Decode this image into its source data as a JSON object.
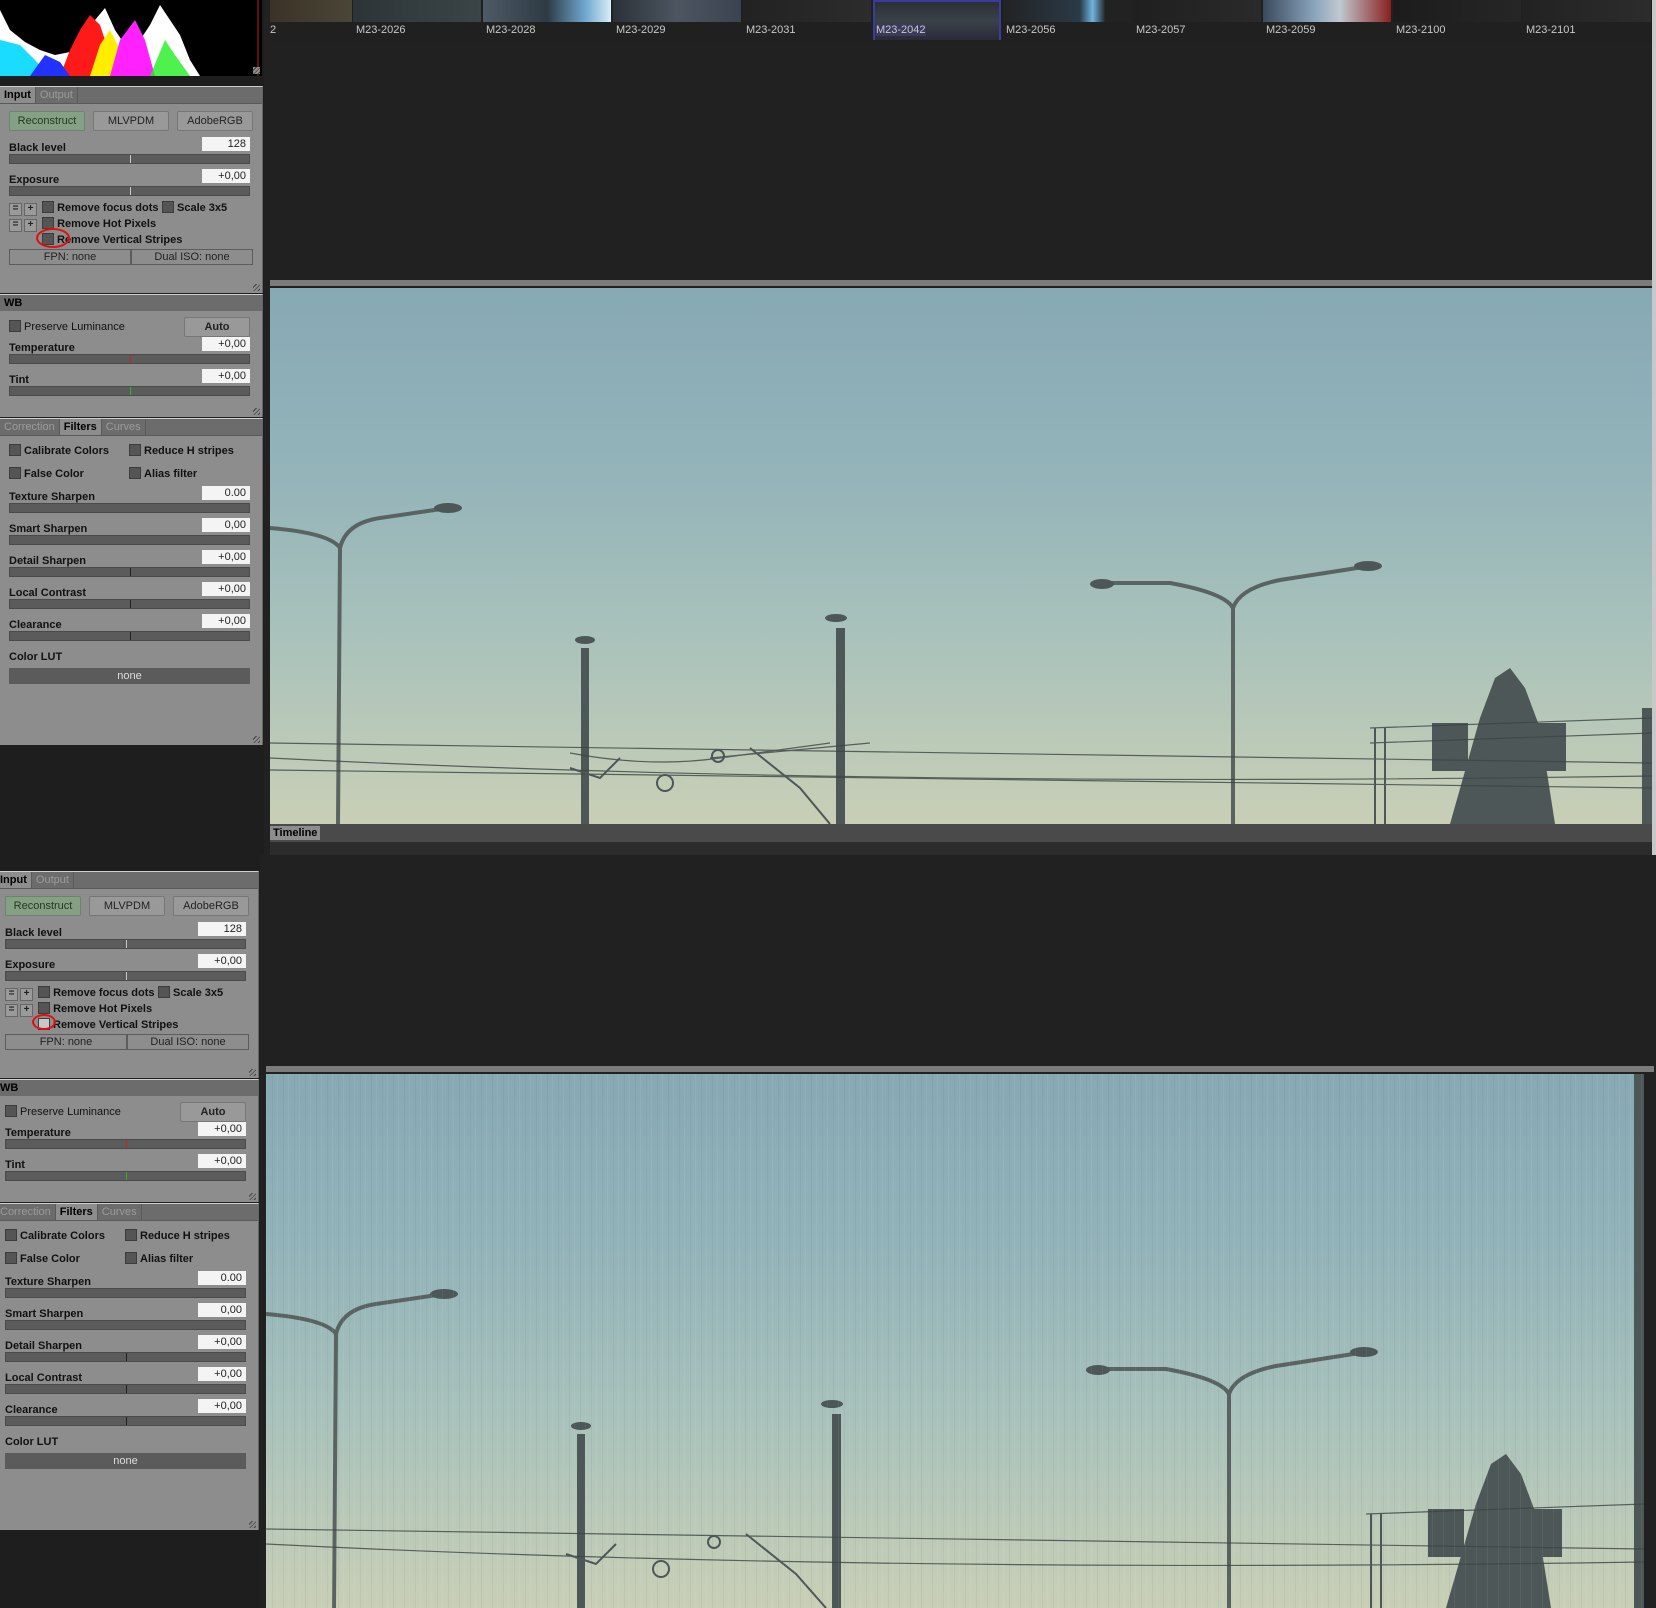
{
  "top": {
    "tabs": [
      "Input",
      "Output"
    ],
    "reconstruct_buttons": [
      "Reconstruct",
      "MLVPDM",
      "AdobeRGB"
    ],
    "black_level": {
      "label": "Black level",
      "value": "128"
    },
    "exposure": {
      "label": "Exposure",
      "value": "+0,00"
    },
    "remove_focus_dots": "Remove focus dots",
    "scale": "Scale 3x5",
    "remove_hot_pixels": "Remove Hot Pixels",
    "remove_vertical_stripes": "Remove Vertical Stripes",
    "fpn": "FPN: none",
    "dual_iso": "Dual ISO: none",
    "wb": {
      "title": "WB",
      "preserve_luminance": "Preserve Luminance",
      "auto": "Auto",
      "temperature": {
        "label": "Temperature",
        "value": "+0,00"
      },
      "tint": {
        "label": "Tint",
        "value": "+0,00"
      }
    },
    "filter_tabs": [
      "Correction",
      "Filters",
      "Curves"
    ],
    "filters": {
      "calibrate_colors": "Calibrate Colors",
      "reduce_h_stripes": "Reduce H stripes",
      "false_color": "False Color",
      "alias_filter": "Alias filter",
      "texture_sharpen": {
        "label": "Texture Sharpen",
        "value": "0.00"
      },
      "smart_sharpen": {
        "label": "Smart Sharpen",
        "value": "0,00"
      },
      "detail_sharpen": {
        "label": "Detail Sharpen",
        "value": "+0,00"
      },
      "local_contrast": {
        "label": "Local Contrast",
        "value": "+0,00"
      },
      "clearance": {
        "label": "Clearance",
        "value": "+0,00"
      },
      "color_lut": {
        "label": "Color LUT",
        "value": "none"
      }
    },
    "filmstrip": [
      "2",
      "M23-2026",
      "M23-2028",
      "M23-2029",
      "M23-2031",
      "M23-2042",
      "M23-2056",
      "M23-2057",
      "M23-2059",
      "M23-2100",
      "M23-2101"
    ],
    "timeline": "Timeline"
  },
  "bottom": {
    "tabs": [
      "Input",
      "Output"
    ],
    "reconstruct_buttons": [
      "Reconstruct",
      "MLVPDM",
      "AdobeRGB"
    ],
    "black_level": {
      "label": "Black level",
      "value": "128"
    },
    "exposure": {
      "label": "Exposure",
      "value": "+0,00"
    },
    "remove_focus_dots": "Remove focus dots",
    "scale": "Scale 3x5",
    "remove_hot_pixels": "Remove Hot Pixels",
    "remove_vertical_stripes": "Remove Vertical Stripes",
    "fpn": "FPN: none",
    "dual_iso": "Dual ISO: none",
    "wb": {
      "title": "WB",
      "preserve_luminance": "Preserve Luminance",
      "auto": "Auto",
      "temperature": {
        "label": "Temperature",
        "value": "+0,00"
      },
      "tint": {
        "label": "Tint",
        "value": "+0,00"
      }
    },
    "filter_tabs": [
      "Correction",
      "Filters",
      "Curves"
    ],
    "filters": {
      "calibrate_colors": "Calibrate Colors",
      "reduce_h_stripes": "Reduce H stripes",
      "false_color": "False Color",
      "alias_filter": "Alias filter",
      "texture_sharpen": {
        "label": "Texture Sharpen",
        "value": "0.00"
      },
      "smart_sharpen": {
        "label": "Smart Sharpen",
        "value": "0,00"
      },
      "detail_sharpen": {
        "label": "Detail Sharpen",
        "value": "+0,00"
      },
      "local_contrast": {
        "label": "Local Contrast",
        "value": "+0,00"
      },
      "clearance": {
        "label": "Clearance",
        "value": "+0,00"
      },
      "color_lut": {
        "label": "Color LUT",
        "value": "none"
      }
    }
  },
  "colors": {
    "panel_bg": "#8d8d8d",
    "active_button": "#85a085",
    "highlight_ring": "#e01010",
    "selected_thumb": "#3a3aa0"
  }
}
